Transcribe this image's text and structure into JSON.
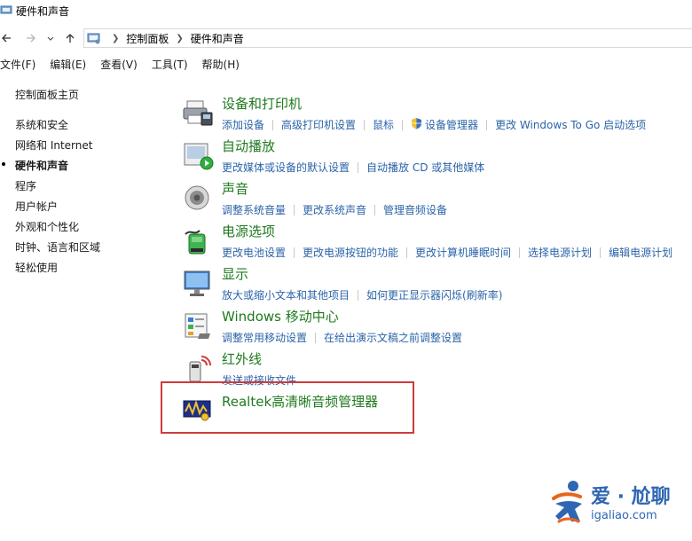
{
  "window": {
    "title": "硬件和声音"
  },
  "breadcrumb": {
    "items": [
      "控制面板",
      "硬件和声音"
    ]
  },
  "menu": [
    "文件(F)",
    "编辑(E)",
    "查看(V)",
    "工具(T)",
    "帮助(H)"
  ],
  "sidebar": {
    "home": "控制面板主页",
    "items": [
      "系统和安全",
      "网络和 Internet",
      "硬件和声音",
      "程序",
      "用户帐户",
      "外观和个性化",
      "时钟、语言和区域",
      "轻松使用"
    ],
    "active_index": 2
  },
  "categories": [
    {
      "title": "设备和打印机",
      "icon": "printer-icon",
      "links": [
        "添加设备",
        "高级打印机设置",
        "鼠标",
        "设备管理器",
        "更改 Windows To Go 启动选项"
      ]
    },
    {
      "title": "自动播放",
      "icon": "autoplay-icon",
      "links": [
        "更改媒体或设备的默认设置",
        "自动播放 CD 或其他媒体"
      ]
    },
    {
      "title": "声音",
      "icon": "speaker-icon",
      "links": [
        "调整系统音量",
        "更改系统声音",
        "管理音频设备"
      ]
    },
    {
      "title": "电源选项",
      "icon": "battery-icon",
      "links": [
        "更改电池设置",
        "更改电源按钮的功能",
        "更改计算机睡眠时间",
        "选择电源计划",
        "编辑电源计划"
      ]
    },
    {
      "title": "显示",
      "icon": "monitor-icon",
      "links": [
        "放大或缩小文本和其他项目",
        "如何更正显示器闪烁(刷新率)"
      ]
    },
    {
      "title": "Windows 移动中心",
      "icon": "mobility-center-icon",
      "links": [
        "调整常用移动设置",
        "在给出演示文稿之前调整设置"
      ]
    },
    {
      "title": "红外线",
      "icon": "infrared-icon",
      "links": [
        "发送或接收文件"
      ]
    },
    {
      "title": "Realtek高清晰音频管理器",
      "icon": "realtek-audio-icon",
      "links": []
    }
  ],
  "watermark": {
    "main": "爱 · 尬聊",
    "sub": "igaliao.com"
  },
  "colors": {
    "category_title": "#1f7a1f",
    "link": "#2b64a8",
    "highlight": "#d03a3a",
    "watermark": "#2f66b3"
  }
}
